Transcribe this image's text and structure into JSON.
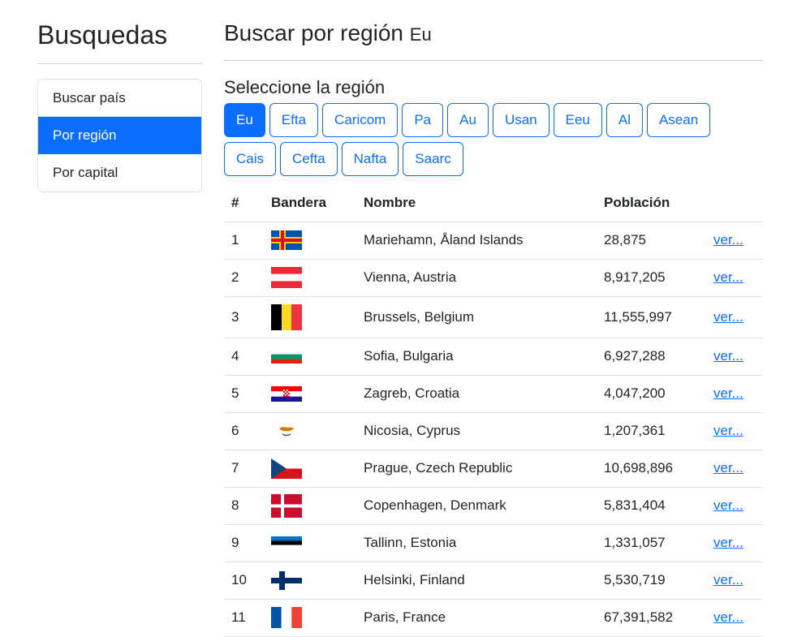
{
  "sidebar": {
    "title": "Busquedas",
    "items": [
      {
        "label": "Buscar país",
        "active": false
      },
      {
        "label": "Por región",
        "active": true
      },
      {
        "label": "Por capital",
        "active": false
      }
    ]
  },
  "main": {
    "title": "Buscar por región",
    "region_code": "Eu",
    "subtitle": "Seleccione la región",
    "regions_row1": [
      "Eu",
      "Efta",
      "Caricom",
      "Pa",
      "Au",
      "Usan",
      "Eeu",
      "Al",
      "Asean"
    ],
    "regions_row2": [
      "Cais",
      "Cefta",
      "Nafta",
      "Saarc"
    ],
    "active_region": "Eu"
  },
  "table": {
    "headers": [
      "#",
      "Bandera",
      "Nombre",
      "Población",
      ""
    ],
    "link_label": "ver...",
    "rows": [
      {
        "num": "1",
        "flag_icon": "aland-flag-icon",
        "name": "Mariehamn, Åland Islands",
        "population": "28,875"
      },
      {
        "num": "2",
        "flag_icon": "austria-flag-icon",
        "name": "Vienna, Austria",
        "population": "8,917,205"
      },
      {
        "num": "3",
        "flag_icon": "belgium-flag-icon",
        "name": "Brussels, Belgium",
        "population": "11,555,997"
      },
      {
        "num": "4",
        "flag_icon": "bulgaria-flag-icon",
        "name": "Sofia, Bulgaria",
        "population": "6,927,288"
      },
      {
        "num": "5",
        "flag_icon": "croatia-flag-icon",
        "name": "Zagreb, Croatia",
        "population": "4,047,200"
      },
      {
        "num": "6",
        "flag_icon": "cyprus-flag-icon",
        "name": "Nicosia, Cyprus",
        "population": "1,207,361"
      },
      {
        "num": "7",
        "flag_icon": "czech-flag-icon",
        "name": "Prague, Czech Republic",
        "population": "10,698,896"
      },
      {
        "num": "8",
        "flag_icon": "denmark-flag-icon",
        "name": "Copenhagen, Denmark",
        "population": "5,831,404"
      },
      {
        "num": "9",
        "flag_icon": "estonia-flag-icon",
        "name": "Tallinn, Estonia",
        "population": "1,331,057"
      },
      {
        "num": "10",
        "flag_icon": "finland-flag-icon",
        "name": "Helsinki, Finland",
        "population": "5,530,719"
      },
      {
        "num": "11",
        "flag_icon": "france-flag-icon",
        "name": "Paris, France",
        "population": "67,391,582"
      }
    ]
  },
  "colors": {
    "accent": "#0d6efd",
    "text": "#212529",
    "border": "#dee2e6"
  }
}
